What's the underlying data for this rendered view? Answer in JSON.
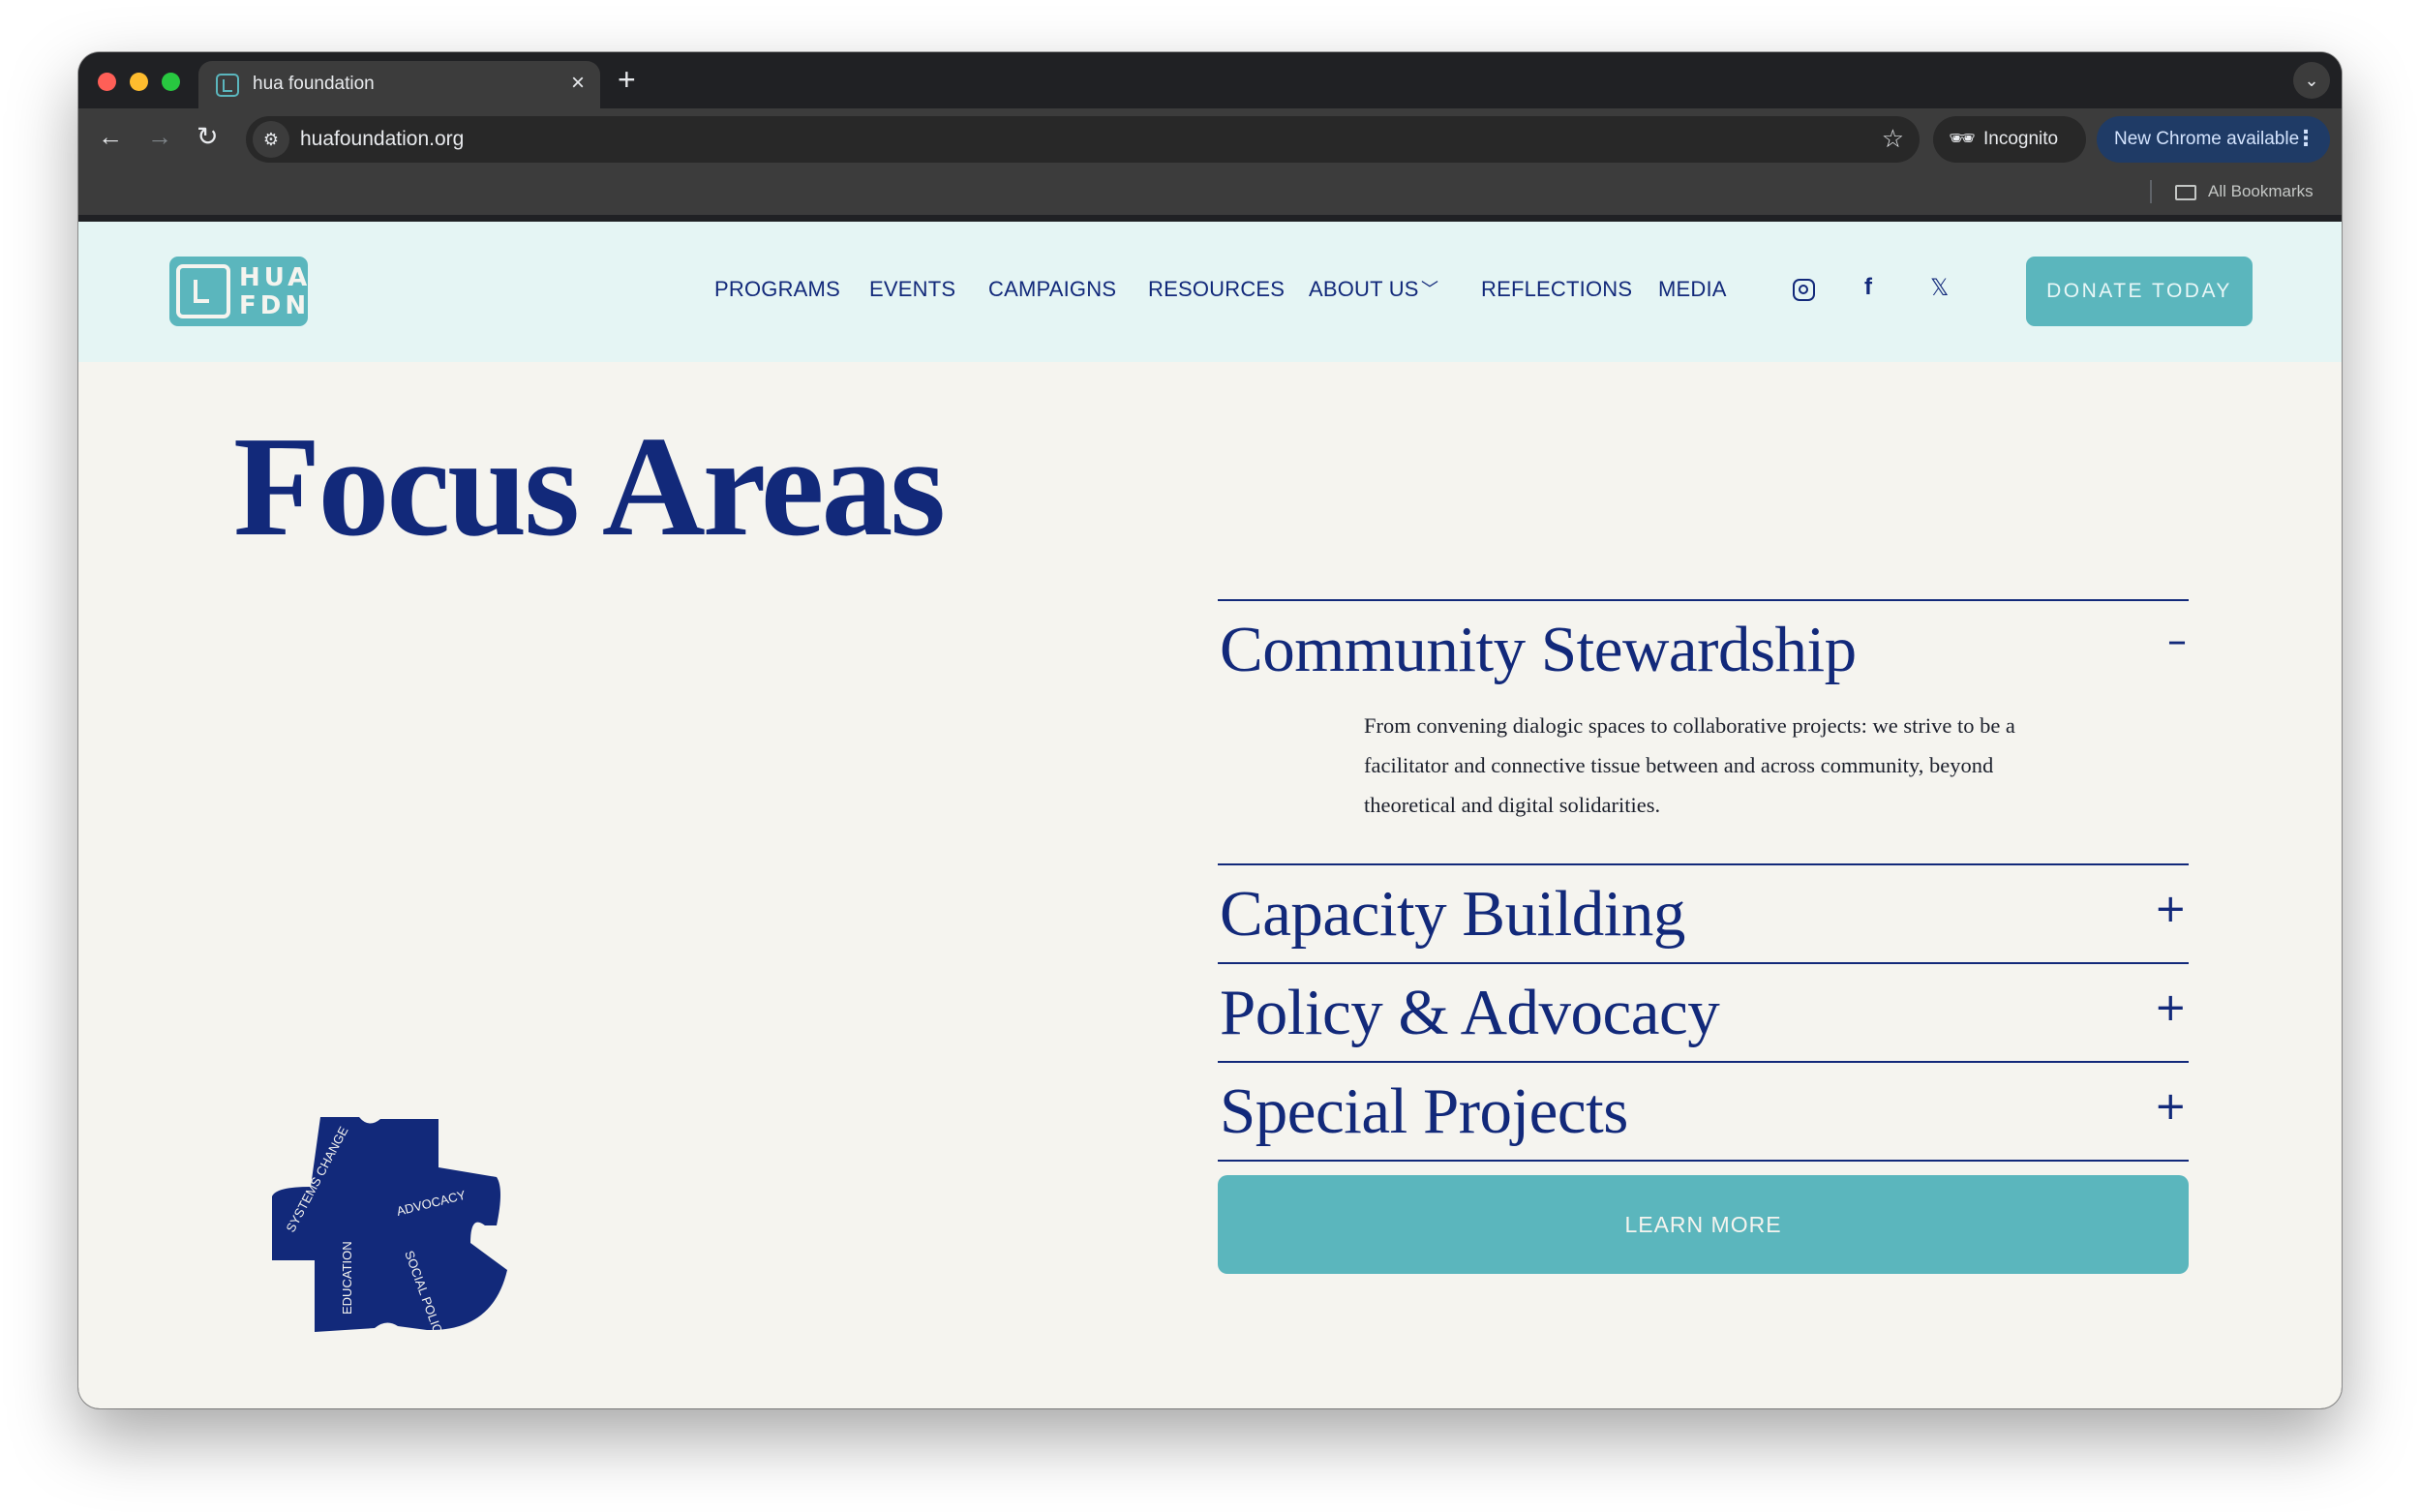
{
  "browser": {
    "tab_title": "hua foundation",
    "tab_close": "×",
    "new_tab": "+",
    "tab_search": "⌄",
    "back": "←",
    "forward": "→",
    "reload": "↻",
    "site_info_icon": "⚙",
    "url": "huafoundation.org",
    "bookmark_star": "☆",
    "incognito_label": "Incognito",
    "incognito_icon": "🕶",
    "update_label": "New Chrome available",
    "update_menu": "⋮",
    "bookmarks_label": "All Bookmarks"
  },
  "site": {
    "logo": {
      "line1": "HUA",
      "line2": "FDN"
    },
    "nav": {
      "programs": "PROGRAMS",
      "events": "EVENTS",
      "campaigns": "CAMPAIGNS",
      "resources": "RESOURCES",
      "about": "ABOUT US",
      "about_chevron": "﹀",
      "reflections": "REFLECTIONS",
      "media": "MEDIA"
    },
    "social": {
      "facebook": "f",
      "x": "𝕏"
    },
    "donate_label": "DONATE TODAY"
  },
  "main": {
    "title": "Focus Areas",
    "accordion": [
      {
        "title": "Community Stewardship",
        "toggle": "–",
        "body": "From convening dialogic spaces to collaborative projects: we strive to be a facilitator and connective tissue between and across community, beyond theoretical and digital solidarities."
      },
      {
        "title": "Capacity Building",
        "toggle": "+"
      },
      {
        "title": "Policy & Advocacy",
        "toggle": "+"
      },
      {
        "title": "Special Projects",
        "toggle": "+"
      }
    ],
    "learn_more_label": "LEARN MORE",
    "puzzle": {
      "labels": {
        "systems_change": "SYSTEMS CHANGE",
        "advocacy": "ADVOCACY",
        "education": "EDUCATION",
        "social_policy": "SOCIAL POLICY"
      },
      "fill": "#12297a"
    }
  },
  "colors": {
    "navy": "#12297a",
    "teal": "#5bb6bd",
    "header_bg": "#e5f5f4",
    "page_bg": "#f5f4ef"
  }
}
